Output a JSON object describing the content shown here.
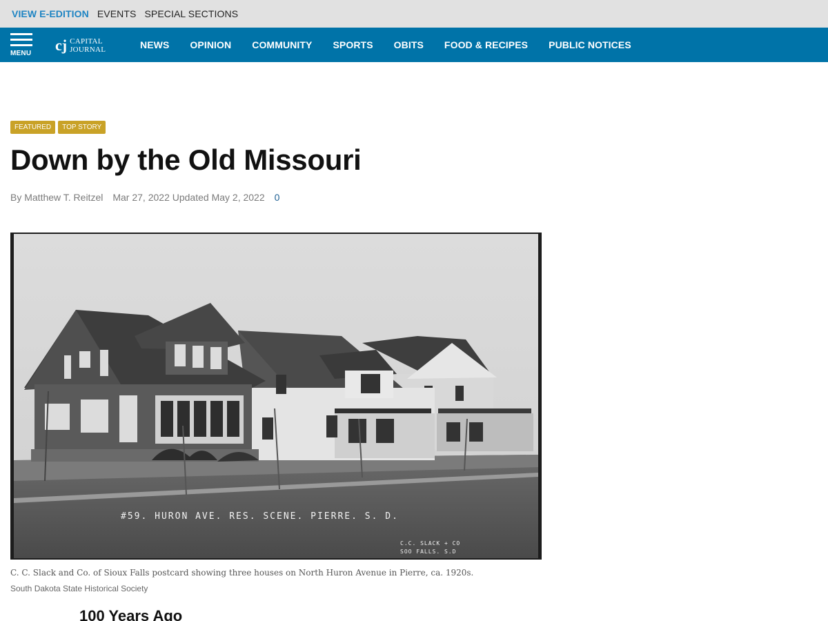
{
  "utility_bar": {
    "links": [
      "VIEW E-EDITION",
      "EVENTS",
      "SPECIAL SECTIONS"
    ]
  },
  "nav": {
    "menu_label": "MENU",
    "logo_mark": "cj",
    "logo_line1": "CAPITAL",
    "logo_line2": "JOURNAL",
    "links": [
      "NEWS",
      "OPINION",
      "COMMUNITY",
      "SPORTS",
      "OBITS",
      "FOOD & RECIPES",
      "PUBLIC NOTICES"
    ]
  },
  "article": {
    "badges": [
      "FEATURED",
      "TOP STORY"
    ],
    "headline": "Down by the Old Missouri",
    "byline": "By Matthew T. Reitzel",
    "date": "Mar 27, 2022 Updated May 2, 2022",
    "comment_count": "0",
    "photo": {
      "inscription": "#59. HURON AVE. RES. SCENE.     PIERRE. S. D.",
      "maker_line1": "C.C. SLACK + CO",
      "maker_line2": "SOO FALLS. S.D"
    },
    "caption": "C. C. Slack and Co. of Sioux Falls postcard showing three houses on North Huron Avenue in Pierre, ca. 1920s.",
    "credit": "South Dakota State Historical Society",
    "subhead": "100 Years Ago"
  },
  "colors": {
    "utility_bg": "#e1e1e1",
    "nav_bg": "#0073a8",
    "accent_link": "#1d84c3",
    "badge_bg": "#c9a227"
  },
  "icons": {
    "menu": "hamburger-icon"
  }
}
